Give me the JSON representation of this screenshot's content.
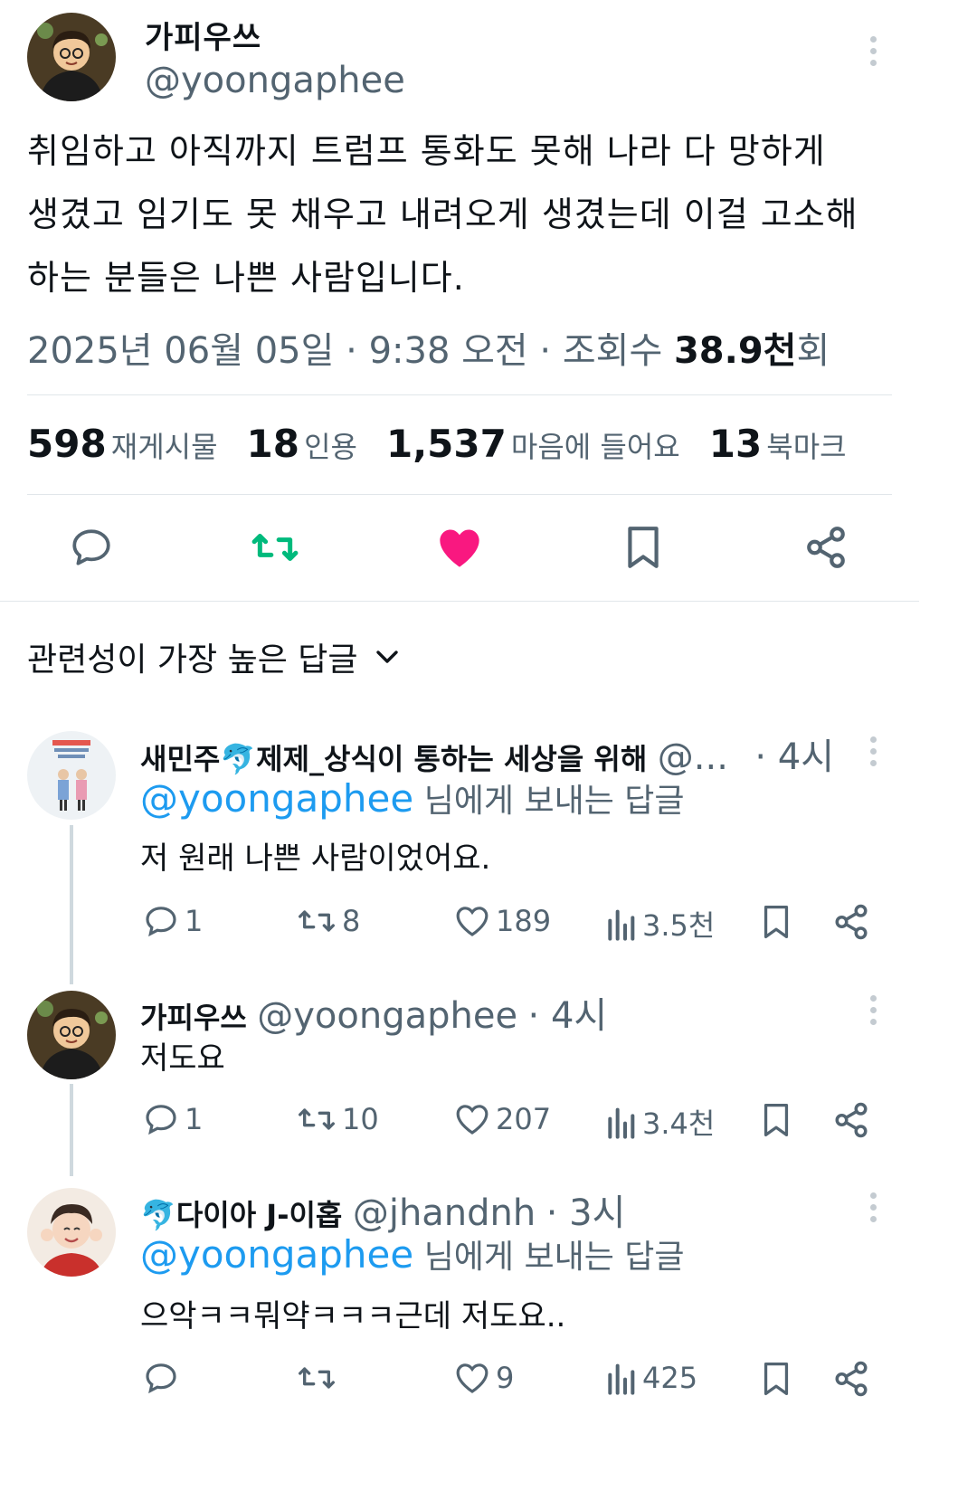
{
  "tweet": {
    "author_name": "가피우쓰",
    "author_handle": "@yoongaphee",
    "text_lines": [
      "취임하고 아직까지 트럼프 통화도 못해 나라 다 망하게",
      "생겼고 임기도 못 채우고 내려오게 생겼는데 이걸 고소해",
      "하는 분들은 나쁜 사람입니다."
    ],
    "meta_date": "2025년 06월 05일 · 9:38 오전 · 조회수 ",
    "meta_views": "38.9천",
    "meta_views_suffix": "회",
    "stats": [
      {
        "num": "598",
        "label": "재게시물"
      },
      {
        "num": "18",
        "label": "인용"
      },
      {
        "num": "1,537",
        "label": "마음에 들어요"
      },
      {
        "num": "13",
        "label": "북마크"
      }
    ]
  },
  "icons": [
    "reply-icon",
    "repost-icon",
    "like-icon",
    "bookmark-icon",
    "share-icon",
    "views-icon",
    "more-icon",
    "chevron-down-icon"
  ],
  "colors": {
    "link": "#1d9bf0",
    "repost": "#00ba7c",
    "like": "#f91880",
    "muted": "#536471"
  },
  "sort_label": "관련성이 가장 높은 답글",
  "replies": [
    {
      "name": "새민주🐬제제_상식이 통하는 세상을 위해",
      "handle": "@...",
      "time": "· 4시",
      "reply_to": "@yoongaphee",
      "reply_to_suffix": "님에게 보내는 답글",
      "text": "저 원래 나쁜 사람이었어요.",
      "replies": "1",
      "reposts": "8",
      "likes": "189",
      "views": "3.5천"
    },
    {
      "name": "가피우쓰",
      "handle": "@yoongaphee",
      "time": "· 4시",
      "text": "저도요",
      "replies": "1",
      "reposts": "10",
      "likes": "207",
      "views": "3.4천"
    },
    {
      "name": "🐬다이아 J-이홉",
      "handle": "@jhandnh",
      "time": "· 3시",
      "reply_to": "@yoongaphee",
      "reply_to_suffix": "님에게 보내는 답글",
      "text": "으악ㅋㅋ뭐약ㅋㅋㅋ근데 저도요..",
      "replies": "",
      "reposts": "",
      "likes": "9",
      "views": "425"
    }
  ]
}
